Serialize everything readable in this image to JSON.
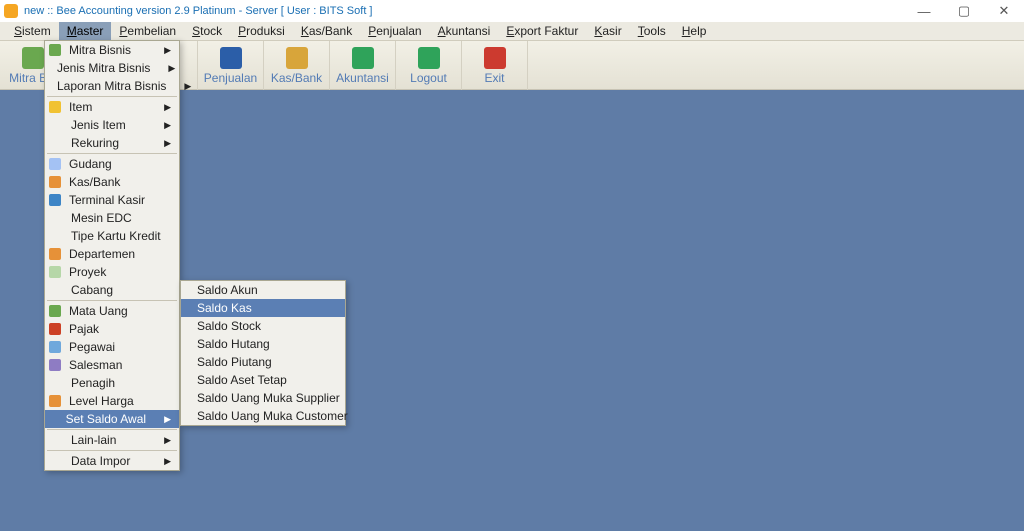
{
  "title": "new :: Bee Accounting version 2.9 Platinum - Server  [ User : BITS Soft ]",
  "menubar": [
    "Sistem",
    "Master",
    "Pembelian",
    "Stock",
    "Produksi",
    "Kas/Bank",
    "Penjualan",
    "Akuntansi",
    "Export Faktur",
    "Kasir",
    "Tools",
    "Help"
  ],
  "menubar_active_index": 1,
  "toolbar": [
    {
      "label": "Mitra Bis",
      "icon": "#6aa84f"
    },
    {
      "label": "",
      "icon": ""
    },
    {
      "label": "",
      "icon": ""
    },
    {
      "label": "Penjualan",
      "icon": "#2b5ea8"
    },
    {
      "label": "Kas/Bank",
      "icon": "#d8a53a"
    },
    {
      "label": "Akuntansi",
      "icon": "#2fa35a"
    },
    {
      "label": "Logout",
      "icon": "#2fa35a"
    },
    {
      "label": "Exit",
      "icon": "#cc3a2f"
    }
  ],
  "master_menu": [
    {
      "label": "Mitra Bisnis",
      "arrow": true,
      "icon": "#6aa84f"
    },
    {
      "label": "Jenis Mitra Bisnis",
      "arrow": true,
      "icon": "#6aa84f"
    },
    {
      "label": "Laporan Mitra Bisnis",
      "arrow": true,
      "icon": "#6aa84f"
    },
    {
      "sep": true
    },
    {
      "label": "Item",
      "arrow": true,
      "icon": "#f1c232"
    },
    {
      "label": "Jenis Item",
      "arrow": true,
      "icon": ""
    },
    {
      "label": "Rekuring",
      "arrow": true,
      "icon": ""
    },
    {
      "sep": true
    },
    {
      "label": "Gudang",
      "icon": "#a4c2f4"
    },
    {
      "label": "Kas/Bank",
      "icon": "#e69138"
    },
    {
      "label": "Terminal Kasir",
      "icon": "#3d85c6"
    },
    {
      "label": "Mesin EDC",
      "icon": ""
    },
    {
      "label": "Tipe Kartu Kredit",
      "icon": ""
    },
    {
      "label": "Departemen",
      "icon": "#e69138"
    },
    {
      "label": "Proyek",
      "icon": "#b6d7a8"
    },
    {
      "label": "Cabang",
      "icon": ""
    },
    {
      "sep": true
    },
    {
      "label": "Mata Uang",
      "icon": "#6aa84f"
    },
    {
      "label": "Pajak",
      "icon": "#cc4125"
    },
    {
      "label": "Pegawai",
      "icon": "#6fa8dc"
    },
    {
      "label": "Salesman",
      "icon": "#8e7cc3"
    },
    {
      "label": "Penagih",
      "icon": ""
    },
    {
      "label": "Level Harga",
      "icon": "#e69138"
    },
    {
      "label": "Set Saldo Awal",
      "arrow": true,
      "highlight": true,
      "icon": ""
    },
    {
      "sep": true
    },
    {
      "label": "Lain-lain",
      "arrow": true,
      "icon": ""
    },
    {
      "sep": true
    },
    {
      "label": "Data Impor",
      "arrow": true,
      "icon": ""
    }
  ],
  "saldo_submenu": [
    {
      "label": "Saldo Akun"
    },
    {
      "label": "Saldo Kas",
      "highlight": true
    },
    {
      "label": "Saldo Stock"
    },
    {
      "label": "Saldo Hutang"
    },
    {
      "label": "Saldo Piutang"
    },
    {
      "label": "Saldo Aset Tetap"
    },
    {
      "label": "Saldo Uang Muka Supplier"
    },
    {
      "label": "Saldo Uang Muka Customer"
    }
  ],
  "win_controls": {
    "min": "—",
    "max": "▢",
    "close": "✕"
  }
}
